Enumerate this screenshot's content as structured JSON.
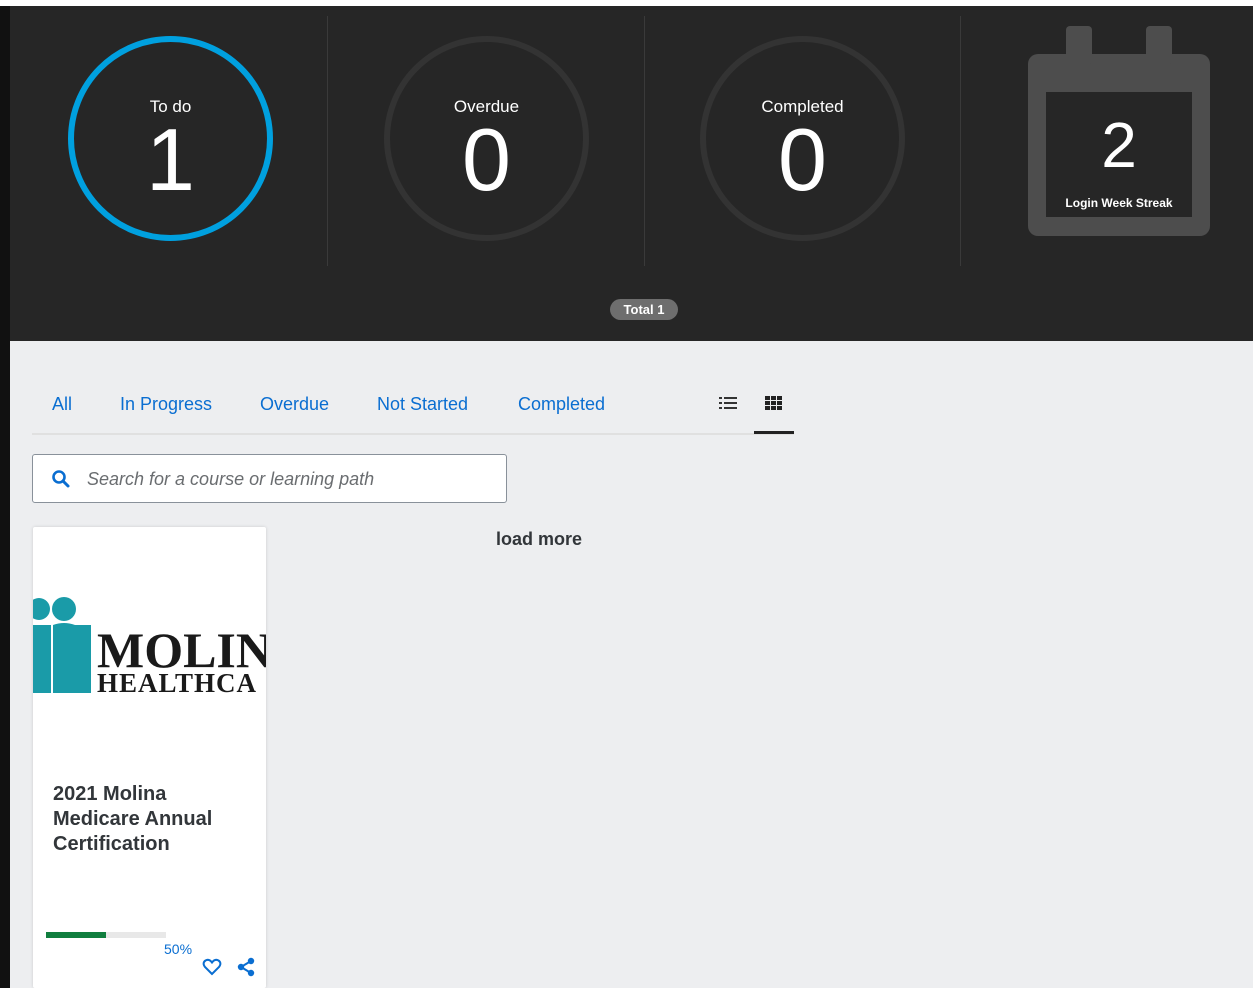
{
  "dashboard": {
    "todo": {
      "label": "To do",
      "value": "1"
    },
    "overdue": {
      "label": "Overdue",
      "value": "0"
    },
    "completed": {
      "label": "Completed",
      "value": "0"
    },
    "streak": {
      "value": "2",
      "label": "Login Week Streak"
    },
    "total_badge": "Total 1",
    "colors": {
      "accent": "#00a0df",
      "background": "#262626",
      "calendar": "#4d4d4d"
    }
  },
  "filters": {
    "tabs": [
      {
        "label": "All"
      },
      {
        "label": "In Progress"
      },
      {
        "label": "Overdue"
      },
      {
        "label": "Not Started"
      },
      {
        "label": "Completed"
      }
    ],
    "views": [
      {
        "icon": "list-view-icon"
      },
      {
        "icon": "grid-view-icon",
        "selected": true
      }
    ]
  },
  "search": {
    "placeholder": "Search for a course or learning path",
    "value": "",
    "icon": "search-icon"
  },
  "courses": [
    {
      "logo_text_top": "MOLIN",
      "logo_text_bottom": "HEALTHCA",
      "title": "2021 Molina Medicare Annual Certification",
      "progress": 50,
      "progress_label": "50%",
      "progress_color": "#107e3e",
      "actions": [
        "heart-icon",
        "share-icon"
      ]
    }
  ],
  "load_more": "load more"
}
